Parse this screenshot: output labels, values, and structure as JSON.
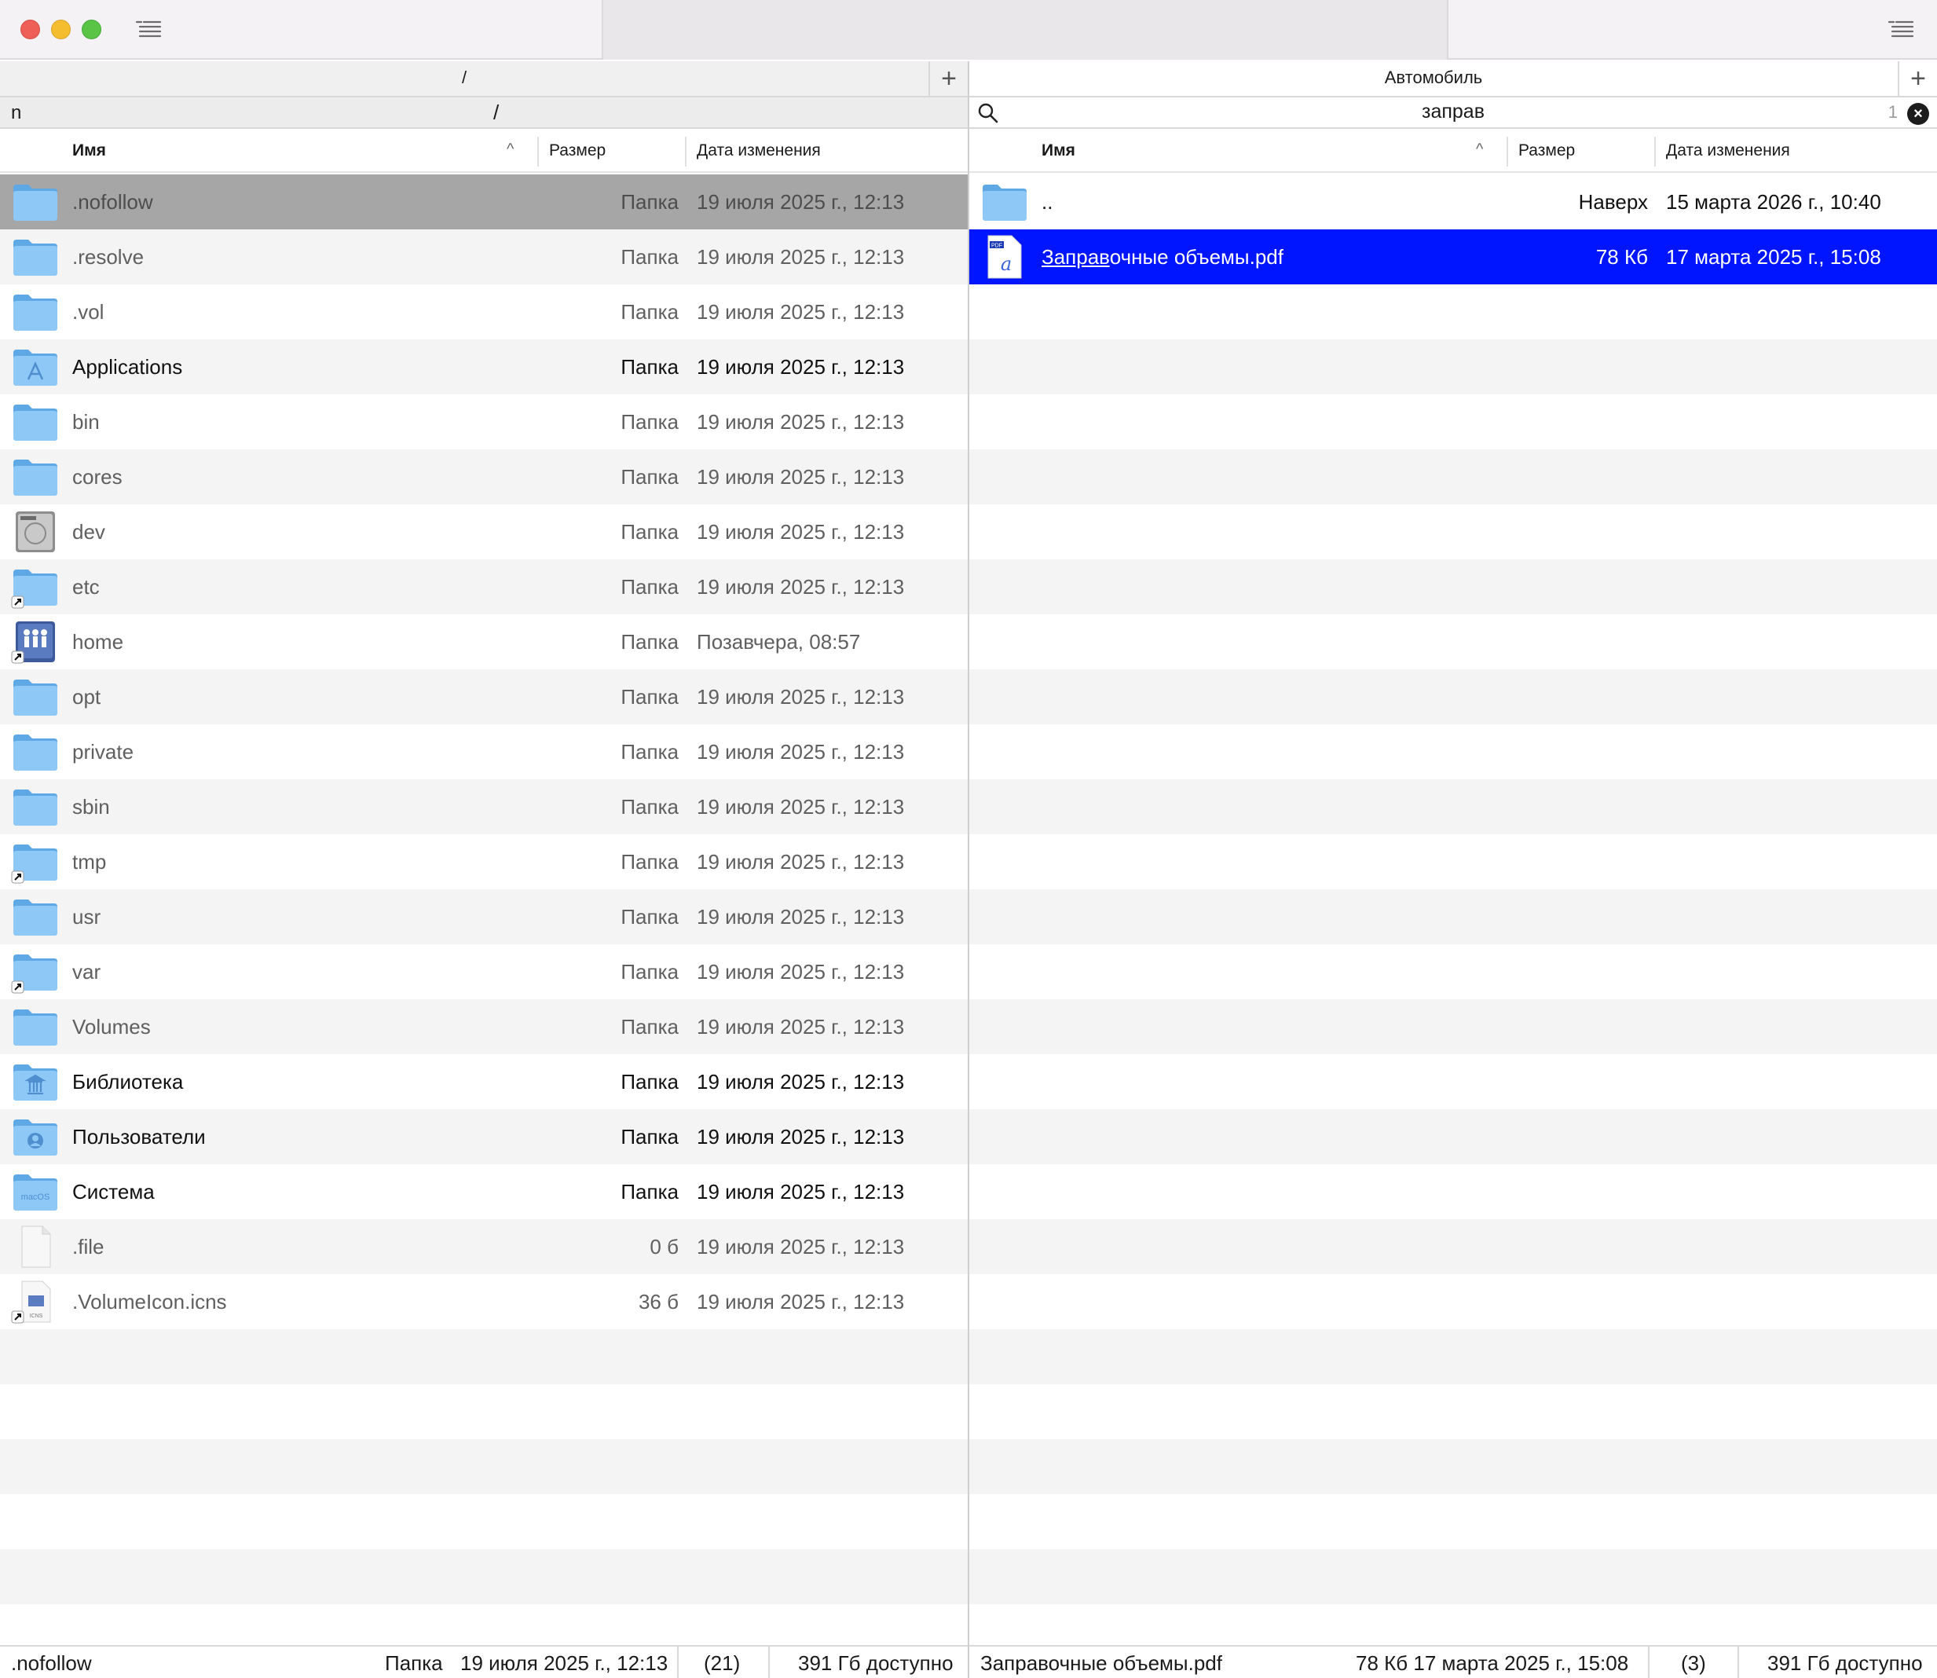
{
  "window": {
    "left_tab_title": "",
    "right_tab_title": ""
  },
  "left": {
    "path": "/",
    "filter": "n",
    "filter_path": "/",
    "columns": {
      "name": "Имя",
      "size": "Размер",
      "date": "Дата изменения"
    },
    "rows": [
      {
        "icon": "folder-icon",
        "name": ".nofollow",
        "size": "Папка",
        "date": "19 июля 2025 г., 12:13",
        "state": "cursor"
      },
      {
        "icon": "folder-icon",
        "name": ".resolve",
        "size": "Папка",
        "date": "19 июля 2025 г., 12:13",
        "state": "normal"
      },
      {
        "icon": "folder-icon",
        "name": ".vol",
        "size": "Папка",
        "date": "19 июля 2025 г., 12:13",
        "state": "normal"
      },
      {
        "icon": "applications-folder-icon",
        "name": "Applications",
        "size": "Папка",
        "date": "19 июля 2025 г., 12:13",
        "state": "bold"
      },
      {
        "icon": "folder-icon",
        "name": "bin",
        "size": "Папка",
        "date": "19 июля 2025 г., 12:13",
        "state": "normal"
      },
      {
        "icon": "folder-icon",
        "name": "cores",
        "size": "Папка",
        "date": "19 июля 2025 г., 12:13",
        "state": "normal"
      },
      {
        "icon": "disk-drive-icon",
        "name": "dev",
        "size": "Папка",
        "date": "19 июля 2025 г., 12:13",
        "state": "normal"
      },
      {
        "icon": "folder-alias-icon",
        "name": "etc",
        "size": "Папка",
        "date": "19 июля 2025 г., 12:13",
        "state": "normal"
      },
      {
        "icon": "network-users-icon",
        "name": "home",
        "size": "Папка",
        "date": "Позавчера, 08:57",
        "state": "normal"
      },
      {
        "icon": "folder-icon",
        "name": "opt",
        "size": "Папка",
        "date": "19 июля 2025 г., 12:13",
        "state": "normal"
      },
      {
        "icon": "folder-icon",
        "name": "private",
        "size": "Папка",
        "date": "19 июля 2025 г., 12:13",
        "state": "normal"
      },
      {
        "icon": "folder-icon",
        "name": "sbin",
        "size": "Папка",
        "date": "19 июля 2025 г., 12:13",
        "state": "normal"
      },
      {
        "icon": "folder-alias-icon",
        "name": "tmp",
        "size": "Папка",
        "date": "19 июля 2025 г., 12:13",
        "state": "normal"
      },
      {
        "icon": "folder-icon",
        "name": "usr",
        "size": "Папка",
        "date": "19 июля 2025 г., 12:13",
        "state": "normal"
      },
      {
        "icon": "folder-alias-icon",
        "name": "var",
        "size": "Папка",
        "date": "19 июля 2025 г., 12:13",
        "state": "normal"
      },
      {
        "icon": "folder-icon",
        "name": "Volumes",
        "size": "Папка",
        "date": "19 июля 2025 г., 12:13",
        "state": "normal"
      },
      {
        "icon": "library-folder-icon",
        "name": "Библиотека",
        "size": "Папка",
        "date": "19 июля 2025 г., 12:13",
        "state": "bold"
      },
      {
        "icon": "users-folder-icon",
        "name": "Пользователи",
        "size": "Папка",
        "date": "19 июля 2025 г., 12:13",
        "state": "bold"
      },
      {
        "icon": "macos-folder-icon",
        "name": "Система",
        "size": "Папка",
        "date": "19 июля 2025 г., 12:13",
        "state": "bold"
      },
      {
        "icon": "file-icon",
        "name": ".file",
        "size": "0 б",
        "date": "19 июля 2025 г., 12:13",
        "state": "normal"
      },
      {
        "icon": "icns-file-icon",
        "name": ".VolumeIcon.icns",
        "size": "36 б",
        "date": "19 июля 2025 г., 12:13",
        "state": "normal"
      }
    ],
    "status": {
      "name": ".nofollow",
      "kind": "Папка",
      "date": "19 июля 2025 г., 12:13",
      "count": "(21)",
      "free": "391 Гб доступно"
    }
  },
  "right": {
    "path": "Автомобиль",
    "search": "заправ",
    "search_count": "1",
    "columns": {
      "name": "Имя",
      "size": "Размер",
      "date": "Дата изменения"
    },
    "rows": [
      {
        "icon": "folder-icon",
        "name": "..",
        "size": "Наверх",
        "date": "15 марта 2026 г., 10:40",
        "state": "dark"
      },
      {
        "icon": "pdf-file-icon",
        "name": "Заправочные объемы.pdf",
        "name_match": "Заправ",
        "name_rest": "очные объемы.pdf",
        "size": "78 Кб",
        "date": "17 марта 2025 г., 15:08",
        "state": "selected"
      }
    ],
    "status": {
      "name": "Заправочные объемы.pdf",
      "size_date": "78 Кб 17 марта 2025 г., 15:08",
      "count": "(3)",
      "free": "391 Гб доступно"
    }
  }
}
